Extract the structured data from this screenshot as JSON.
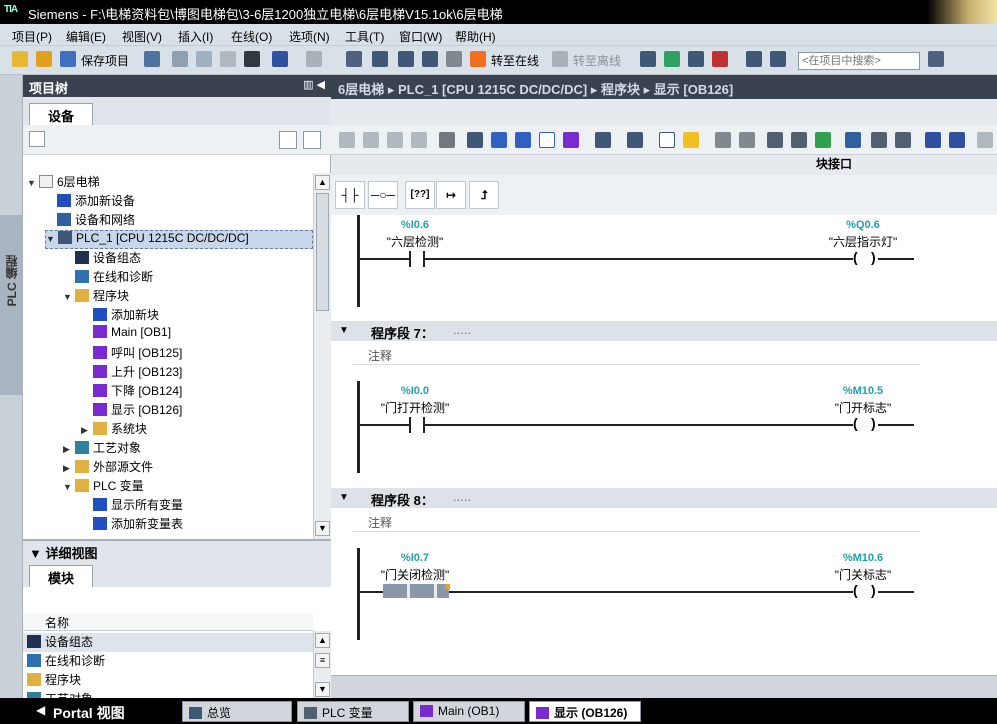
{
  "window": {
    "title": "Siemens - F:\\电梯资料包\\博图电梯包\\3-6层1200独立电梯\\6层电梯V15.1ok\\6层电梯"
  },
  "menu": [
    "项目(P)",
    "编辑(E)",
    "视图(V)",
    "插入(I)",
    "在线(O)",
    "选项(N)",
    "工具(T)",
    "窗口(W)",
    "帮助(H)"
  ],
  "toolbar": {
    "save_project": "保存项目",
    "go_online": "转至在线",
    "go_offline": "转至离线",
    "search_placeholder": "<在项目中搜索>"
  },
  "left_strip": {
    "label": "PLC 编程"
  },
  "project_tree": {
    "title": "项目树",
    "tab": "设备",
    "items": [
      {
        "label": "6层电梯",
        "icon": "project-icon",
        "level": 0,
        "arrow": "▼"
      },
      {
        "label": "添加新设备",
        "icon": "add-device-icon",
        "level": 1,
        "arrow": ""
      },
      {
        "label": "设备和网络",
        "icon": "network-icon",
        "level": 1,
        "arrow": ""
      },
      {
        "label": "PLC_1 [CPU 1215C DC/DC/DC]",
        "icon": "plc-icon",
        "level": 1,
        "arrow": "▼",
        "selected": true
      },
      {
        "label": "设备组态",
        "icon": "device-config-icon",
        "level": 2,
        "arrow": ""
      },
      {
        "label": "在线和诊断",
        "icon": "diagnostics-icon",
        "level": 2,
        "arrow": ""
      },
      {
        "label": "程序块",
        "icon": "folder-icon",
        "level": 2,
        "arrow": "▼"
      },
      {
        "label": "添加新块",
        "icon": "add-block-icon",
        "level": 3,
        "arrow": ""
      },
      {
        "label": "Main [OB1]",
        "icon": "ob-icon",
        "level": 3,
        "arrow": ""
      },
      {
        "label": "呼叫 [OB125]",
        "icon": "ob-icon",
        "level": 3,
        "arrow": ""
      },
      {
        "label": "上升 [OB123]",
        "icon": "ob-icon",
        "level": 3,
        "arrow": ""
      },
      {
        "label": "下降 [OB124]",
        "icon": "ob-icon",
        "level": 3,
        "arrow": ""
      },
      {
        "label": "显示 [OB126]",
        "icon": "ob-icon",
        "level": 3,
        "arrow": ""
      },
      {
        "label": "系统块",
        "icon": "folder-icon",
        "level": 3,
        "arrow": "▶"
      },
      {
        "label": "工艺对象",
        "icon": "tech-object-icon",
        "level": 2,
        "arrow": "▶"
      },
      {
        "label": "外部源文件",
        "icon": "folder-icon",
        "level": 2,
        "arrow": "▶"
      },
      {
        "label": "PLC 变量",
        "icon": "folder-icon",
        "level": 2,
        "arrow": "▼"
      },
      {
        "label": "显示所有变量",
        "icon": "tag-table-icon",
        "level": 3,
        "arrow": ""
      },
      {
        "label": "添加新变量表",
        "icon": "add-tag-table-icon",
        "level": 3,
        "arrow": ""
      }
    ]
  },
  "detail_view": {
    "title": "详细视图",
    "tab": "模块",
    "column": "名称",
    "rows": [
      {
        "label": "设备组态",
        "icon": "device-config-icon"
      },
      {
        "label": "在线和诊断",
        "icon": "diagnostics-icon"
      },
      {
        "label": "程序块",
        "icon": "folder-icon"
      },
      {
        "label": "工艺对象",
        "icon": "tech-object-icon"
      }
    ]
  },
  "breadcrumb": [
    "6层电梯",
    "PLC_1 [CPU 1215C DC/DC/DC]",
    "程序块",
    "显示 [OB126]"
  ],
  "editor": {
    "block_interface": "块接口",
    "instructions": [
      "┤├",
      "─○─",
      "[??]",
      "↦",
      "⮥"
    ]
  },
  "networks": [
    {
      "header": "",
      "comment": "",
      "contact": {
        "addr": "%I0.6",
        "sym": "\"六层检测\""
      },
      "coil": {
        "addr": "%Q0.6",
        "sym": "\"六层指示灯\""
      }
    },
    {
      "header": "程序段 7：",
      "dots": ".....",
      "comment": "注释",
      "contact": {
        "addr": "%I0.0",
        "sym": "\"门打开检测\""
      },
      "coil": {
        "addr": "%M10.5",
        "sym": "\"门开标志\""
      }
    },
    {
      "header": "程序段 8：",
      "dots": ".....",
      "comment": "注释",
      "contact": {
        "addr": "%I0.7",
        "sym": "\"门关闭检测\""
      },
      "coil": {
        "addr": "%M10.6",
        "sym": "\"门关标志\""
      }
    }
  ],
  "taskbar": {
    "portal": "Portal 视图",
    "tabs": [
      "总览",
      "PLC 变量",
      "Main (OB1)",
      "显示 (OB126)"
    ]
  },
  "colors": {
    "title_bg": "#000000",
    "header_bg": "#3a4250",
    "address": "#20a0b0",
    "ob_icon": "#7a2bd0",
    "accent": "#f0a020"
  }
}
